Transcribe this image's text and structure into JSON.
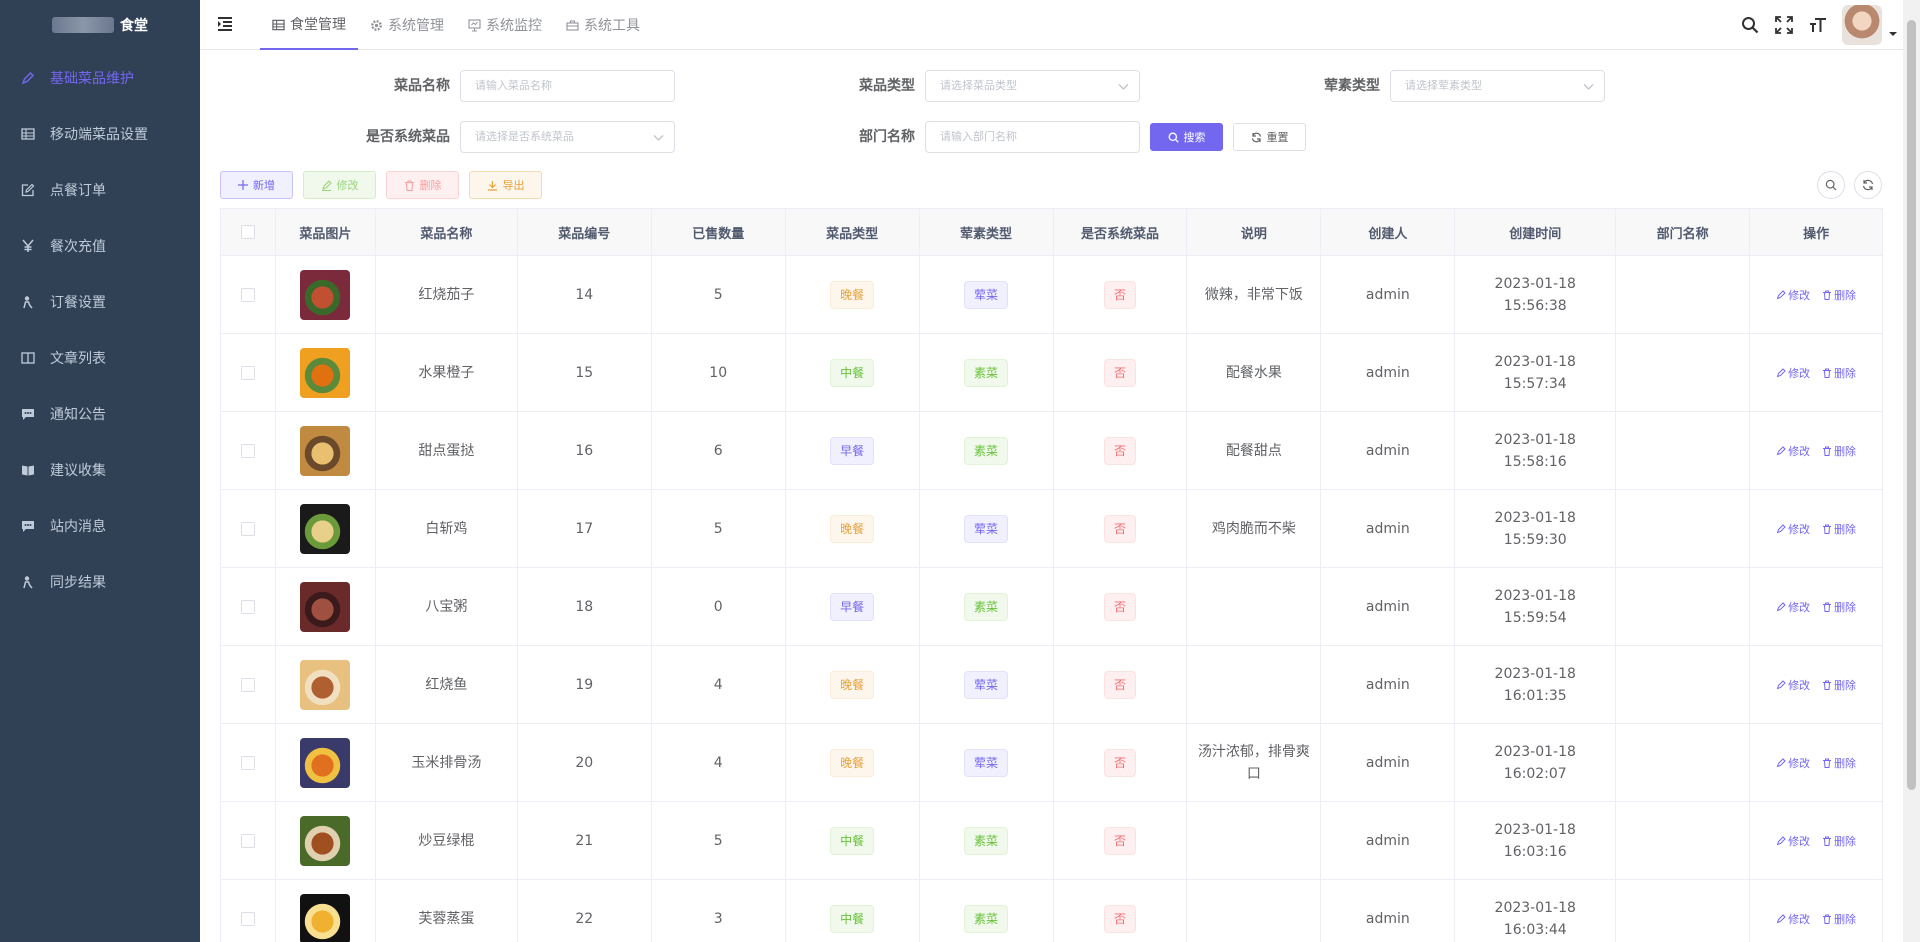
{
  "app": {
    "title": "食堂"
  },
  "sidebar": {
    "items": [
      {
        "label": "基础菜品维护",
        "icon": "edit-icon",
        "active": true
      },
      {
        "label": "移动端菜品设置",
        "icon": "table-icon"
      },
      {
        "label": "点餐订单",
        "icon": "edit-square-icon"
      },
      {
        "label": "餐次充值",
        "icon": "yen-icon"
      },
      {
        "label": "订餐设置",
        "icon": "user-icon"
      },
      {
        "label": "文章列表",
        "icon": "book-icon"
      },
      {
        "label": "通知公告",
        "icon": "message-icon"
      },
      {
        "label": "建议收集",
        "icon": "book-open-icon"
      },
      {
        "label": "站内消息",
        "icon": "message-icon"
      },
      {
        "label": "同步结果",
        "icon": "user-icon"
      }
    ]
  },
  "topnav": {
    "tabs": [
      {
        "label": "食堂管理",
        "icon": "table-icon",
        "active": true
      },
      {
        "label": "系统管理",
        "icon": "gear-icon"
      },
      {
        "label": "系统监控",
        "icon": "monitor-icon"
      },
      {
        "label": "系统工具",
        "icon": "toolbox-icon"
      }
    ]
  },
  "search": {
    "dish_name_label": "菜品名称",
    "dish_name_placeholder": "请输入菜品名称",
    "dish_type_label": "菜品类型",
    "dish_type_placeholder": "请选择菜品类型",
    "meat_type_label": "荤素类型",
    "meat_type_placeholder": "请选择荤素类型",
    "is_system_label": "是否系统菜品",
    "is_system_placeholder": "请选择是否系统菜品",
    "dept_label": "部门名称",
    "dept_placeholder": "请输入部门名称",
    "search_btn": "搜索",
    "reset_btn": "重置"
  },
  "toolbar": {
    "add": "新增",
    "edit": "修改",
    "delete": "删除",
    "export": "导出"
  },
  "table": {
    "headers": [
      "菜品图片",
      "菜品名称",
      "菜品编号",
      "已售数量",
      "菜品类型",
      "荤素类型",
      "是否系统菜品",
      "说明",
      "创建人",
      "创建时间",
      "部门名称",
      "操作"
    ],
    "op_edit": "修改",
    "op_delete": "删除",
    "rows": [
      {
        "name": "红烧茄子",
        "code": "14",
        "sold": "5",
        "type": "晚餐",
        "type_kind": "wan",
        "meat": "荤菜",
        "meat_kind": "hun",
        "system": "否",
        "desc": "微辣，非常下饭",
        "creator": "admin",
        "time": "2023-01-18 15:56:38",
        "dept": "",
        "img_colors": [
          "#7a2a3a",
          "#c0502f",
          "#3a6a2a"
        ]
      },
      {
        "name": "水果橙子",
        "code": "15",
        "sold": "10",
        "type": "中餐",
        "type_kind": "zhong",
        "meat": "素菜",
        "meat_kind": "su",
        "system": "否",
        "desc": "配餐水果",
        "creator": "admin",
        "time": "2023-01-18 15:57:34",
        "dept": "",
        "img_colors": [
          "#f0a020",
          "#e07010",
          "#5a8a3a"
        ]
      },
      {
        "name": "甜点蛋挞",
        "code": "16",
        "sold": "6",
        "type": "早餐",
        "type_kind": "zao",
        "meat": "素菜",
        "meat_kind": "su",
        "system": "否",
        "desc": "配餐甜点",
        "creator": "admin",
        "time": "2023-01-18 15:58:16",
        "dept": "",
        "img_colors": [
          "#c08a40",
          "#e8c070",
          "#6a4a2a"
        ]
      },
      {
        "name": "白斩鸡",
        "code": "17",
        "sold": "5",
        "type": "晚餐",
        "type_kind": "wan",
        "meat": "荤菜",
        "meat_kind": "hun",
        "system": "否",
        "desc": "鸡肉脆而不柴",
        "creator": "admin",
        "time": "2023-01-18 15:59:30",
        "dept": "",
        "img_colors": [
          "#1a1a1a",
          "#e8d08a",
          "#6a9a3a"
        ]
      },
      {
        "name": "八宝粥",
        "code": "18",
        "sold": "0",
        "type": "早餐",
        "type_kind": "zao",
        "meat": "素菜",
        "meat_kind": "su",
        "system": "否",
        "desc": "",
        "creator": "admin",
        "time": "2023-01-18 15:59:54",
        "dept": "",
        "img_colors": [
          "#6a2a2a",
          "#a05040",
          "#3a1a1a"
        ]
      },
      {
        "name": "红烧鱼",
        "code": "19",
        "sold": "4",
        "type": "晚餐",
        "type_kind": "wan",
        "meat": "荤菜",
        "meat_kind": "hun",
        "system": "否",
        "desc": "",
        "creator": "admin",
        "time": "2023-01-18 16:01:35",
        "dept": "",
        "img_colors": [
          "#e8c080",
          "#b06030",
          "#f0e0c0"
        ]
      },
      {
        "name": "玉米排骨汤",
        "code": "20",
        "sold": "4",
        "type": "晚餐",
        "type_kind": "wan",
        "meat": "荤菜",
        "meat_kind": "hun",
        "system": "否",
        "desc": "汤汁浓郁，排骨爽口",
        "creator": "admin",
        "time": "2023-01-18 16:02:07",
        "dept": "",
        "img_colors": [
          "#3a3a6a",
          "#e07020",
          "#f0c040"
        ]
      },
      {
        "name": "炒豆绿棍",
        "code": "21",
        "sold": "5",
        "type": "中餐",
        "type_kind": "zhong",
        "meat": "素菜",
        "meat_kind": "su",
        "system": "否",
        "desc": "",
        "creator": "admin",
        "time": "2023-01-18 16:03:16",
        "dept": "",
        "img_colors": [
          "#4a6a2a",
          "#a05020",
          "#e0d0b0"
        ]
      },
      {
        "name": "芙蓉蒸蛋",
        "code": "22",
        "sold": "3",
        "type": "中餐",
        "type_kind": "zhong",
        "meat": "素菜",
        "meat_kind": "su",
        "system": "否",
        "desc": "",
        "creator": "admin",
        "time": "2023-01-18 16:03:44",
        "dept": "",
        "img_colors": [
          "#111111",
          "#f0b030",
          "#f8e090"
        ]
      }
    ]
  },
  "colors": {
    "accent": "#7367f0",
    "sidebar_bg": "#304156",
    "sidebar_text": "#bfcbd9"
  }
}
